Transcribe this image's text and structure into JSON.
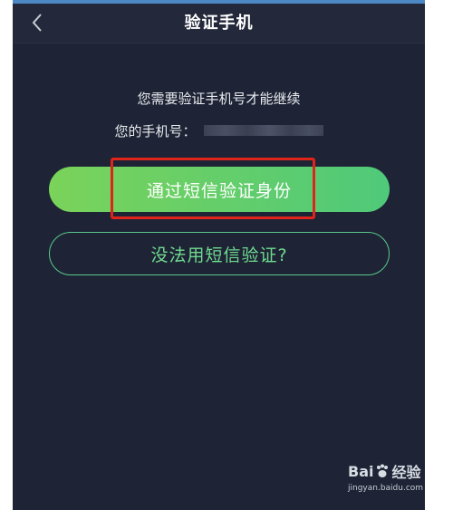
{
  "header": {
    "back_icon": "chevron-left-icon",
    "title": "验证手机"
  },
  "main": {
    "prompt": "您需要验证手机号才能继续",
    "phone_label": "您的手机号：",
    "verify_button": "通过短信验证身份",
    "alt_button": "没法用短信验证?"
  },
  "watermark": {
    "brand_left": "Bai",
    "brand_right": "经验",
    "url": "jingyan.baidu.com"
  },
  "colors": {
    "background": "#1e2435",
    "accent_green": "#5fcf6a",
    "highlight_red": "#e0241a"
  }
}
